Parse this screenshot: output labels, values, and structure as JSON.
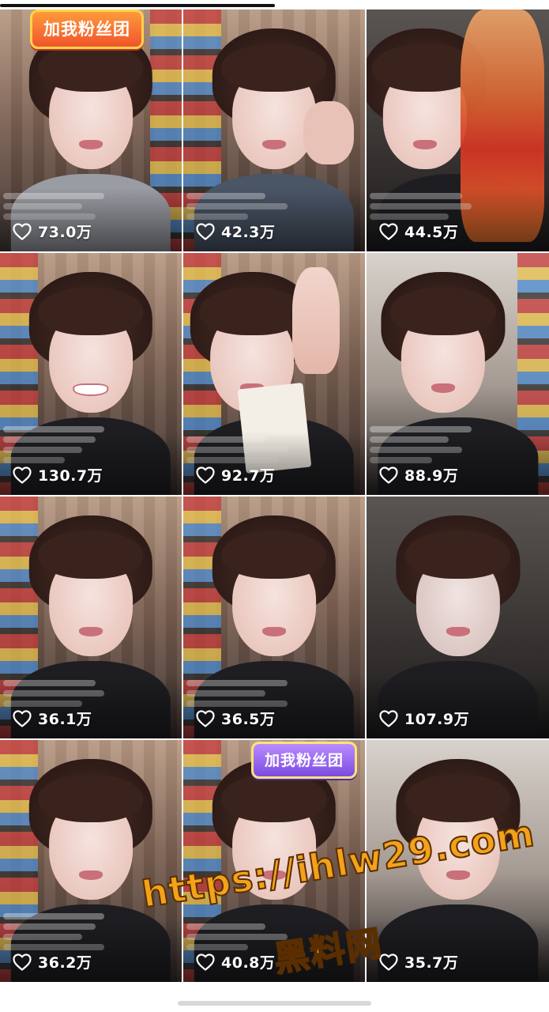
{
  "feed": {
    "items": [
      {
        "likes": "73.0万",
        "badge": "加我粉丝团"
      },
      {
        "likes": "42.3万"
      },
      {
        "likes": "44.5万"
      },
      {
        "likes": "130.7万"
      },
      {
        "likes": "92.7万"
      },
      {
        "likes": "88.9万"
      },
      {
        "likes": "36.1万"
      },
      {
        "likes": "36.5万"
      },
      {
        "likes": "107.9万"
      },
      {
        "likes": "36.2万"
      },
      {
        "likes": "40.8万",
        "badge": "加我粉丝团"
      },
      {
        "likes": "35.7万"
      }
    ]
  },
  "watermark": {
    "url": "https://ihlw29.com",
    "name": "黑料网"
  },
  "icons": {
    "like": "heart-outline-icon"
  },
  "colors": {
    "like_text": "#ffffff",
    "watermark": "#f2a21b",
    "badge_orange": "#f0542b",
    "badge_purple": "#7b4ce0"
  }
}
